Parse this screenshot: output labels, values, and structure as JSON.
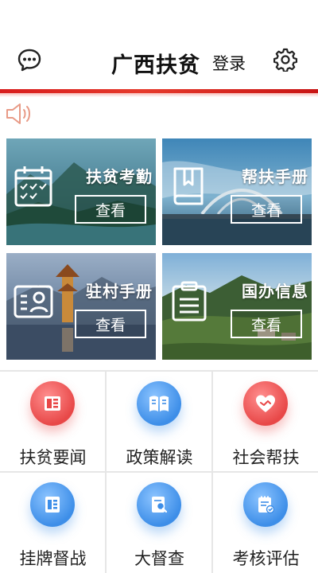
{
  "header": {
    "title": "广西扶贫",
    "login_label": "登录",
    "left_icon": "chat-icon",
    "right_icon": "gear-icon",
    "accent_color": "#d81d1d"
  },
  "notice": {
    "icon": "speaker-icon"
  },
  "cards": [
    {
      "title": "扶贫考勤",
      "button": "查看",
      "icon": "calendar-icon"
    },
    {
      "title": "帮扶手册",
      "button": "查看",
      "icon": "book-icon"
    },
    {
      "title": "驻村手册",
      "button": "查看",
      "icon": "id-card-icon"
    },
    {
      "title": "国办信息",
      "button": "查看",
      "icon": "clipboard-icon"
    }
  ],
  "grid": [
    {
      "label": "扶贫要闻",
      "icon": "news-icon",
      "color": "#e84848"
    },
    {
      "label": "政策解读",
      "icon": "open-book-icon",
      "color": "#3d8ee8"
    },
    {
      "label": "社会帮扶",
      "icon": "heart-handshake-icon",
      "color": "#e84848"
    },
    {
      "label": "挂牌督战",
      "icon": "document-icon",
      "color": "#3d8ee8"
    },
    {
      "label": "大督查",
      "icon": "search-document-icon",
      "color": "#3d8ee8"
    },
    {
      "label": "考核评估",
      "icon": "checklist-icon",
      "color": "#3d8ee8"
    }
  ]
}
